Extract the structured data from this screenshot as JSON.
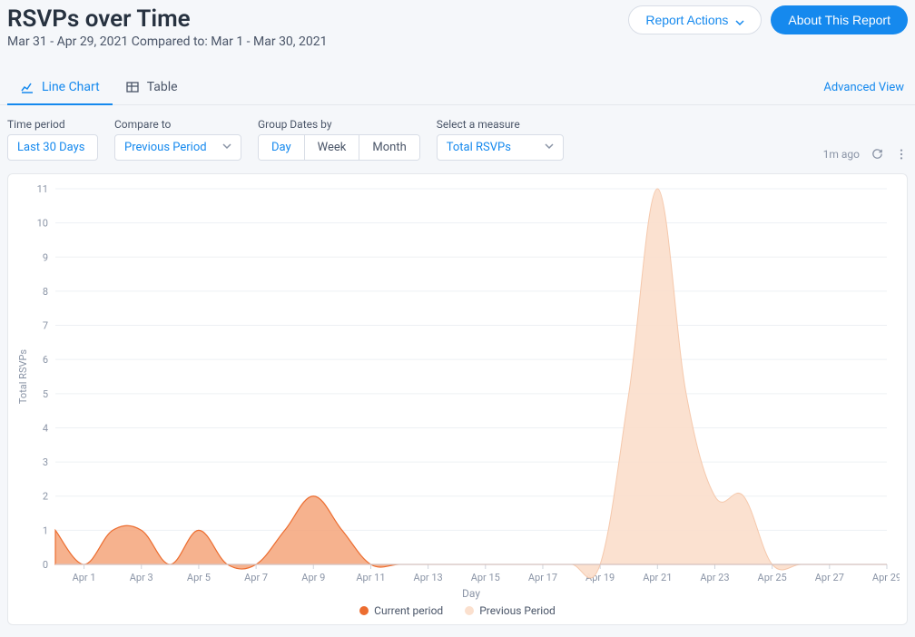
{
  "header": {
    "title": "RSVPs over Time",
    "date_range": "Mar 31 - Apr 29, 2021 Compared to: Mar 1 - Mar 30, 2021",
    "report_actions_label": "Report Actions",
    "about_report_label": "About This Report"
  },
  "tabs": {
    "line_chart": "Line Chart",
    "table": "Table",
    "advanced_view": "Advanced View"
  },
  "controls": {
    "time_period_label": "Time period",
    "time_period_value": "Last 30 Days",
    "compare_to_label": "Compare to",
    "compare_to_value": "Previous Period",
    "group_by_label": "Group Dates by",
    "group_day": "Day",
    "group_week": "Week",
    "group_month": "Month",
    "measure_label": "Select a measure",
    "measure_value": "Total RSVPs",
    "refresh_age": "1m ago"
  },
  "legend": {
    "current": "Current period",
    "previous": "Previous Period"
  },
  "colors": {
    "current_fill": "#f5a47a",
    "current_stroke": "#ec6d30",
    "previous_fill": "#fbe0ce",
    "previous_stroke": "#f5c6a8",
    "grid": "#edf0f4",
    "axis_text": "#8a94a6"
  },
  "chart_data": {
    "type": "area",
    "xlabel": "Day",
    "ylabel": "Total RSVPs",
    "ylim": [
      0,
      11
    ],
    "y_ticks": [
      0,
      1,
      2,
      3,
      4,
      5,
      6,
      7,
      8,
      9,
      10,
      11
    ],
    "x_ticks": [
      "Apr 1",
      "Apr 3",
      "Apr 5",
      "Apr 7",
      "Apr 9",
      "Apr 11",
      "Apr 13",
      "Apr 15",
      "Apr 17",
      "Apr 19",
      "Apr 21",
      "Apr 23",
      "Apr 25",
      "Apr 27",
      "Apr 29"
    ],
    "categories": [
      "Mar 31",
      "Apr 1",
      "Apr 2",
      "Apr 3",
      "Apr 4",
      "Apr 5",
      "Apr 6",
      "Apr 7",
      "Apr 8",
      "Apr 9",
      "Apr 10",
      "Apr 11",
      "Apr 12",
      "Apr 13",
      "Apr 14",
      "Apr 15",
      "Apr 16",
      "Apr 17",
      "Apr 18",
      "Apr 19",
      "Apr 20",
      "Apr 21",
      "Apr 22",
      "Apr 23",
      "Apr 24",
      "Apr 25",
      "Apr 26",
      "Apr 27",
      "Apr 28",
      "Apr 29"
    ],
    "series": [
      {
        "name": "Current period",
        "values": [
          1,
          0,
          1,
          1,
          0,
          1,
          0,
          0,
          1,
          2,
          1,
          0,
          0,
          0,
          0,
          0,
          0,
          0,
          0,
          0,
          0,
          0,
          0,
          0,
          0,
          0,
          0,
          0,
          0,
          0
        ]
      },
      {
        "name": "Previous Period",
        "values": [
          0,
          0,
          0,
          0,
          0,
          0,
          0,
          0,
          0,
          0,
          0,
          0,
          0,
          0,
          0,
          0,
          0,
          0,
          0,
          0,
          5,
          11,
          5,
          2,
          2,
          0,
          0,
          0,
          0,
          0
        ]
      }
    ]
  }
}
